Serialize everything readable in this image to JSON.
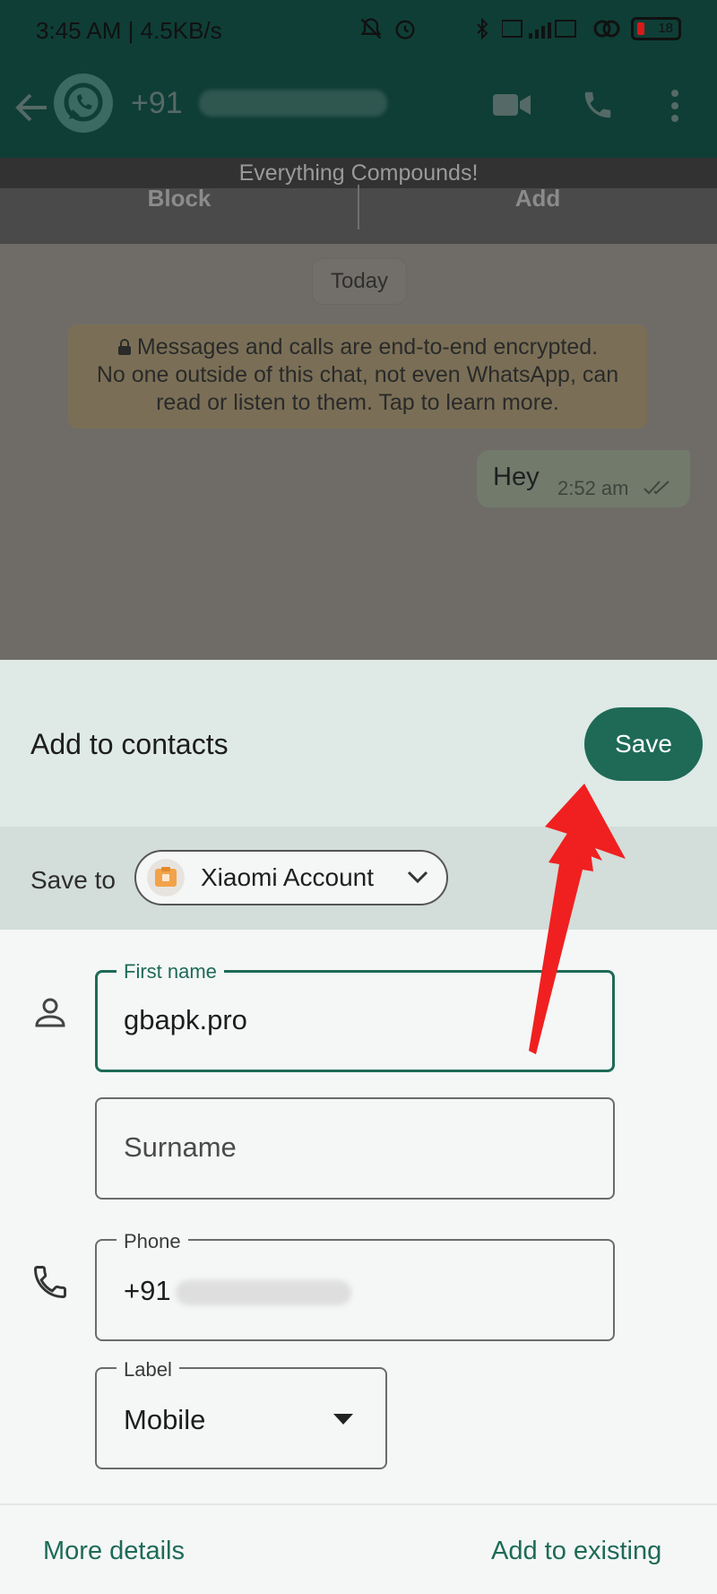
{
  "status_bar": {
    "time_speed": "3:45 AM | 4.5KB/s",
    "battery": "18",
    "icons": [
      "mute-icon",
      "alarm-icon",
      "bluetooth-icon",
      "signal-icon",
      "wifi-icon",
      "battery-icon"
    ]
  },
  "header": {
    "contact_number_prefix": "+91",
    "icons": [
      "back-arrow-icon",
      "whatsapp-avatar",
      "video-call-icon",
      "voice-call-icon",
      "more-menu-icon"
    ]
  },
  "banner": {
    "text": "Everything Compounds!",
    "block_label": "Block",
    "add_label": "Add"
  },
  "chat": {
    "date_pill": "Today",
    "encryption_lines": [
      "Messages and calls are end-to-end encrypted.",
      "No one outside of this chat, not even WhatsApp, can",
      "read or listen to them. Tap to learn more."
    ],
    "message": {
      "text": "Hey",
      "time": "2:52 am"
    }
  },
  "sheet": {
    "title": "Add to contacts",
    "save_label": "Save",
    "save_to_label": "Save to",
    "account_name": "Xiaomi Account"
  },
  "form": {
    "first_name_label": "First name",
    "first_name_value": "gbapk.pro",
    "surname_placeholder": "Surname",
    "phone_label": "Phone",
    "phone_prefix": "+91",
    "type_label": "Label",
    "type_value": "Mobile"
  },
  "footer": {
    "more_details": "More details",
    "add_to_existing": "Add to existing"
  },
  "colors": {
    "accent": "#1e6a57",
    "header_bg": "#0f3e36",
    "annotation": "#f02020"
  }
}
